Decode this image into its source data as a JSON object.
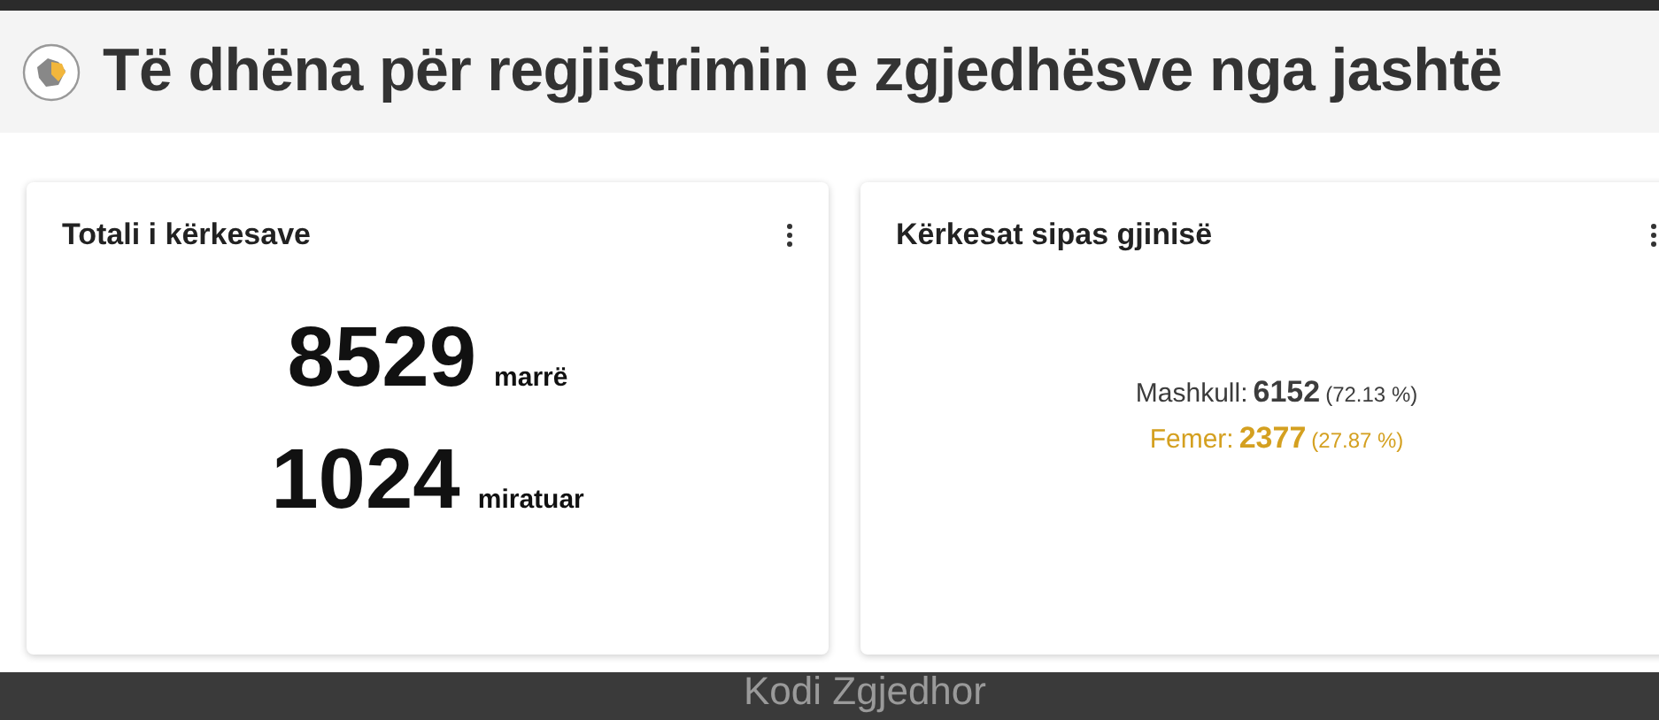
{
  "header": {
    "title": "Të dhëna për regjistrimin e zgjedhësve nga jashtë"
  },
  "cards": [
    {
      "kind": "totals",
      "title": "Totali i kërkesave",
      "rows": [
        {
          "value": "8529",
          "label": "marrë"
        },
        {
          "value": "1024",
          "label": "miratuar"
        }
      ]
    },
    {
      "kind": "gender",
      "title": "Kërkesat sipas gjinisë",
      "rows": [
        {
          "label": "Mashkull:",
          "value": "6152",
          "percent": "(72.13 %)",
          "color": "#3c3c3c"
        },
        {
          "label": "Femer:",
          "value": "2377",
          "percent": "(27.87 %)",
          "color": "#d4a020"
        }
      ]
    }
  ],
  "footer": {
    "text": "Kodi Zgjedhor"
  }
}
